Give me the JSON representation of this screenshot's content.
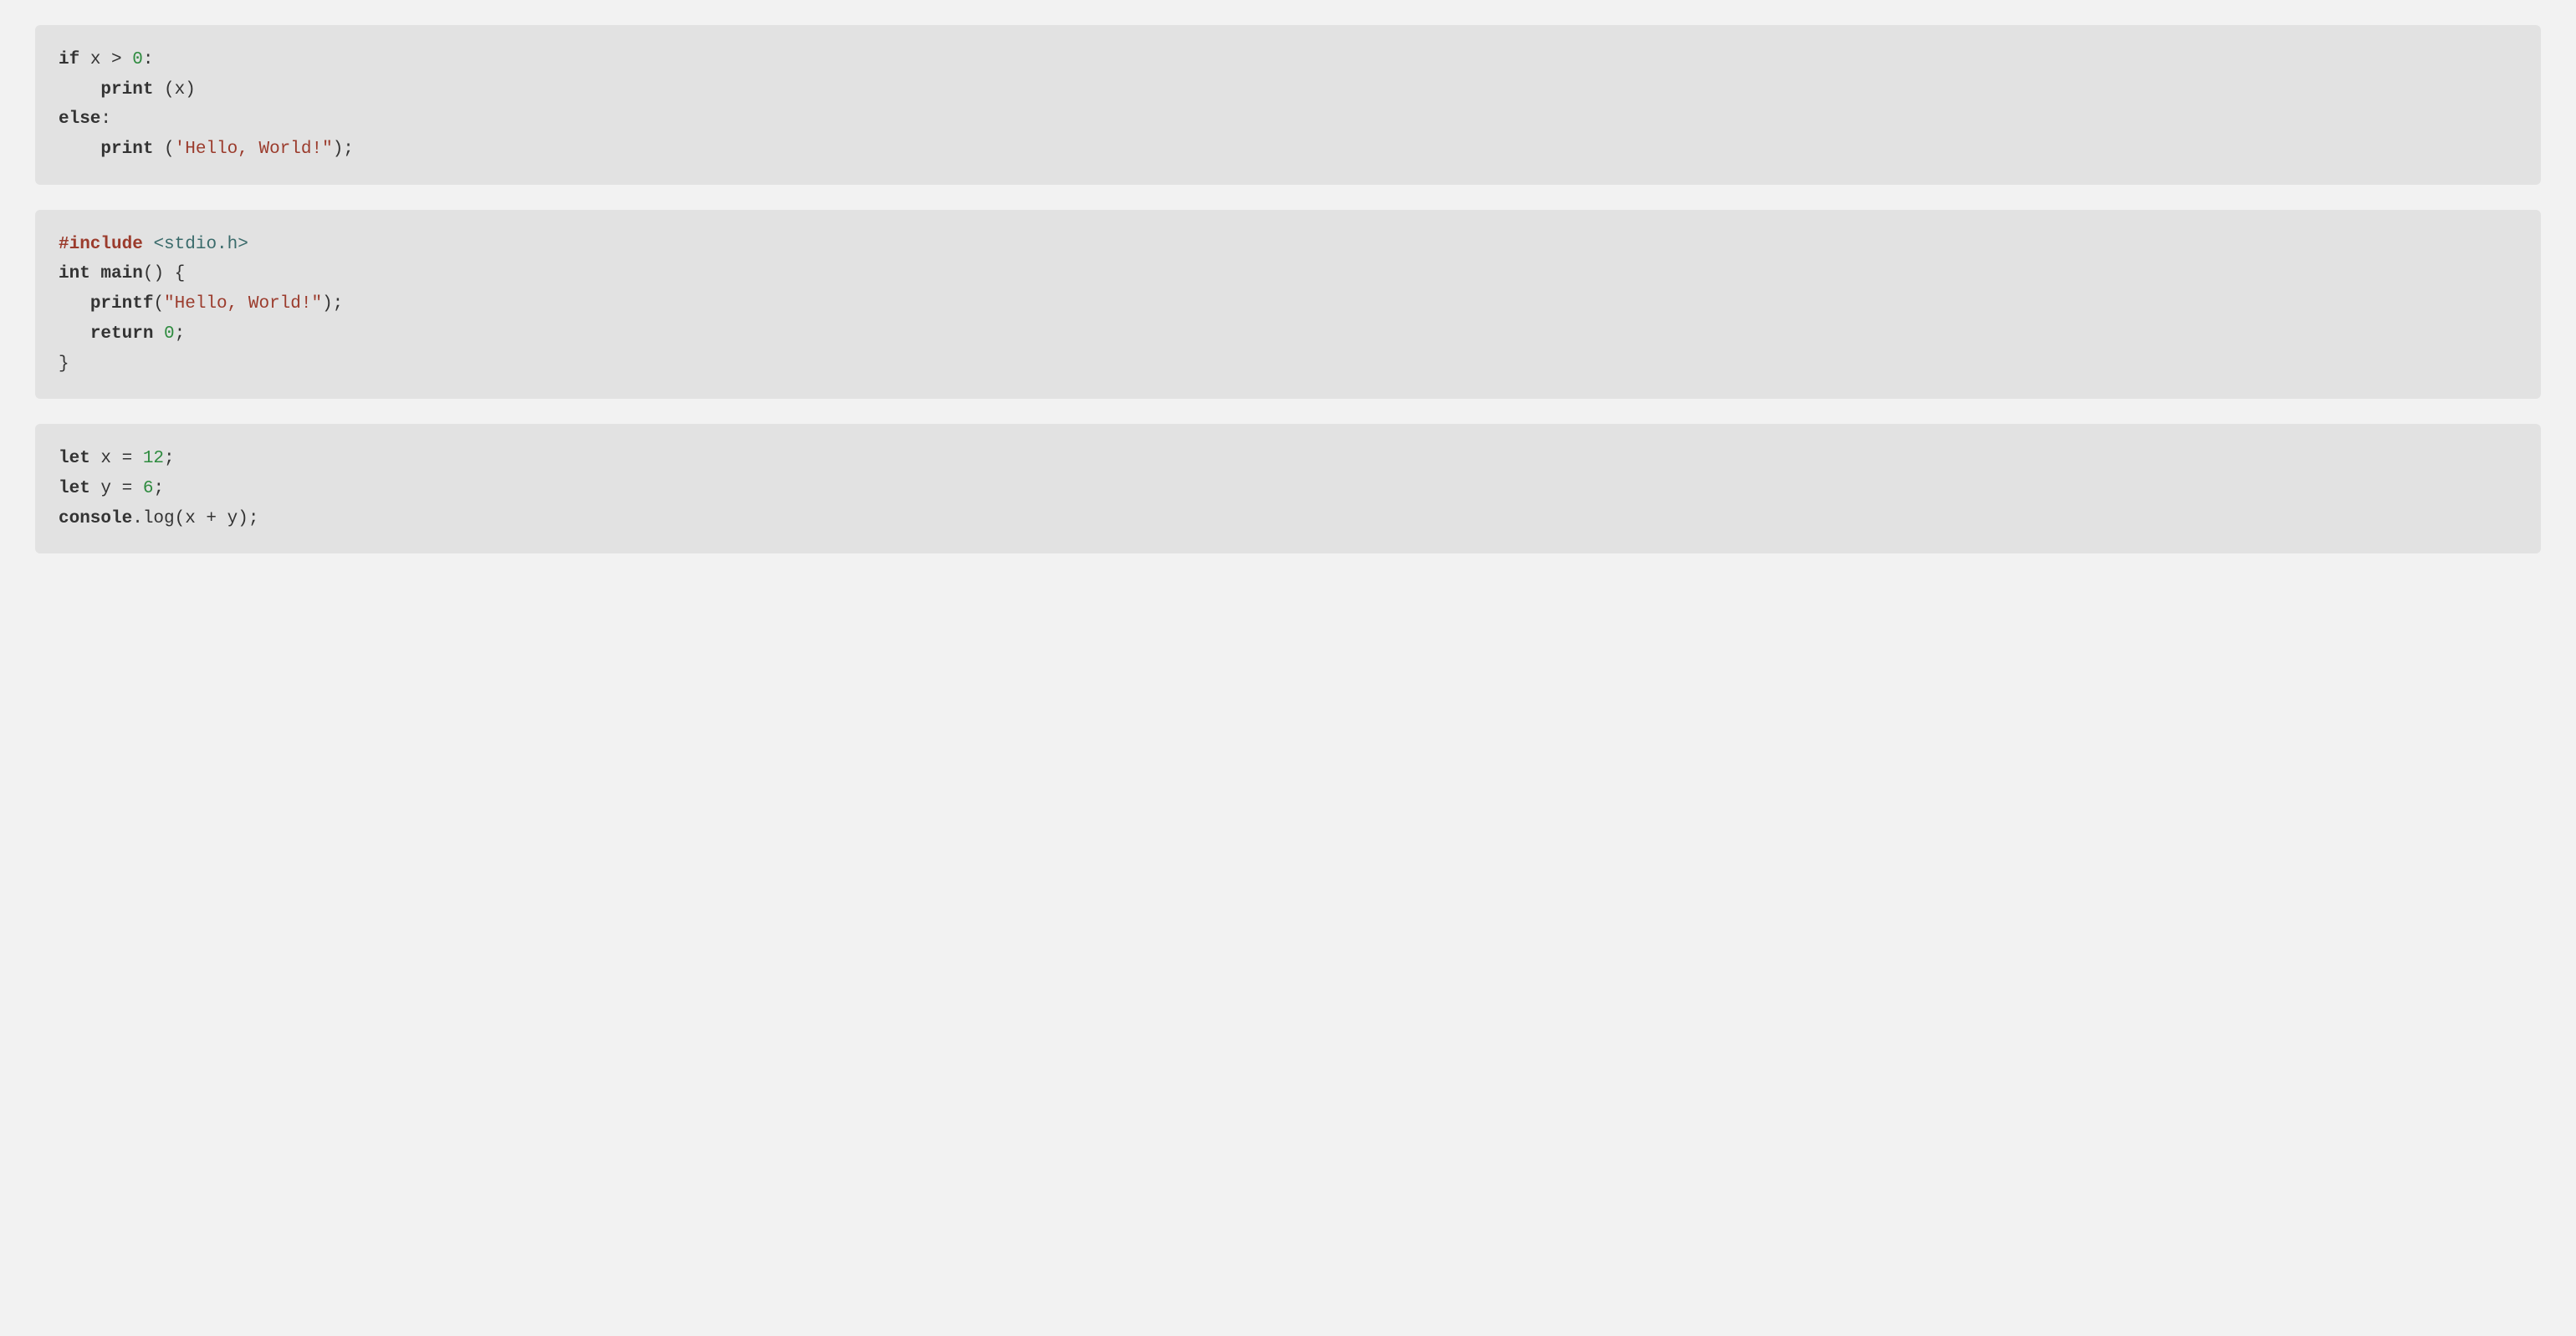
{
  "blocks": [
    {
      "tokens": [
        {
          "t": "if",
          "c": "kw"
        },
        {
          "t": " x > "
        },
        {
          "t": "0",
          "c": "num"
        },
        {
          "t": ":"
        },
        {
          "t": "\n    "
        },
        {
          "t": "print",
          "c": "func"
        },
        {
          "t": " (x)"
        },
        {
          "t": "\n"
        },
        {
          "t": "else",
          "c": "kw"
        },
        {
          "t": ":"
        },
        {
          "t": "\n    "
        },
        {
          "t": "print",
          "c": "func"
        },
        {
          "t": " ("
        },
        {
          "t": "'Hello, World!\"",
          "c": "str"
        },
        {
          "t": ");"
        }
      ]
    },
    {
      "tokens": [
        {
          "t": "#include",
          "c": "pp"
        },
        {
          "t": " "
        },
        {
          "t": "<stdio.h>",
          "c": "inc"
        },
        {
          "t": "\n"
        },
        {
          "t": "int",
          "c": "kw"
        },
        {
          "t": " "
        },
        {
          "t": "main",
          "c": "func"
        },
        {
          "t": "() {"
        },
        {
          "t": "\n   "
        },
        {
          "t": "printf",
          "c": "func"
        },
        {
          "t": "("
        },
        {
          "t": "\"Hello, World!\"",
          "c": "str"
        },
        {
          "t": ");"
        },
        {
          "t": "\n   "
        },
        {
          "t": "return",
          "c": "kw"
        },
        {
          "t": " "
        },
        {
          "t": "0",
          "c": "num"
        },
        {
          "t": ";"
        },
        {
          "t": "\n}"
        }
      ]
    },
    {
      "tokens": [
        {
          "t": "let",
          "c": "kw"
        },
        {
          "t": " x = "
        },
        {
          "t": "12",
          "c": "num"
        },
        {
          "t": ";"
        },
        {
          "t": "\n"
        },
        {
          "t": "let",
          "c": "kw"
        },
        {
          "t": " y = "
        },
        {
          "t": "6",
          "c": "num"
        },
        {
          "t": ";"
        },
        {
          "t": "\n"
        },
        {
          "t": "console",
          "c": "func"
        },
        {
          "t": ".log(x + y);"
        }
      ]
    }
  ]
}
